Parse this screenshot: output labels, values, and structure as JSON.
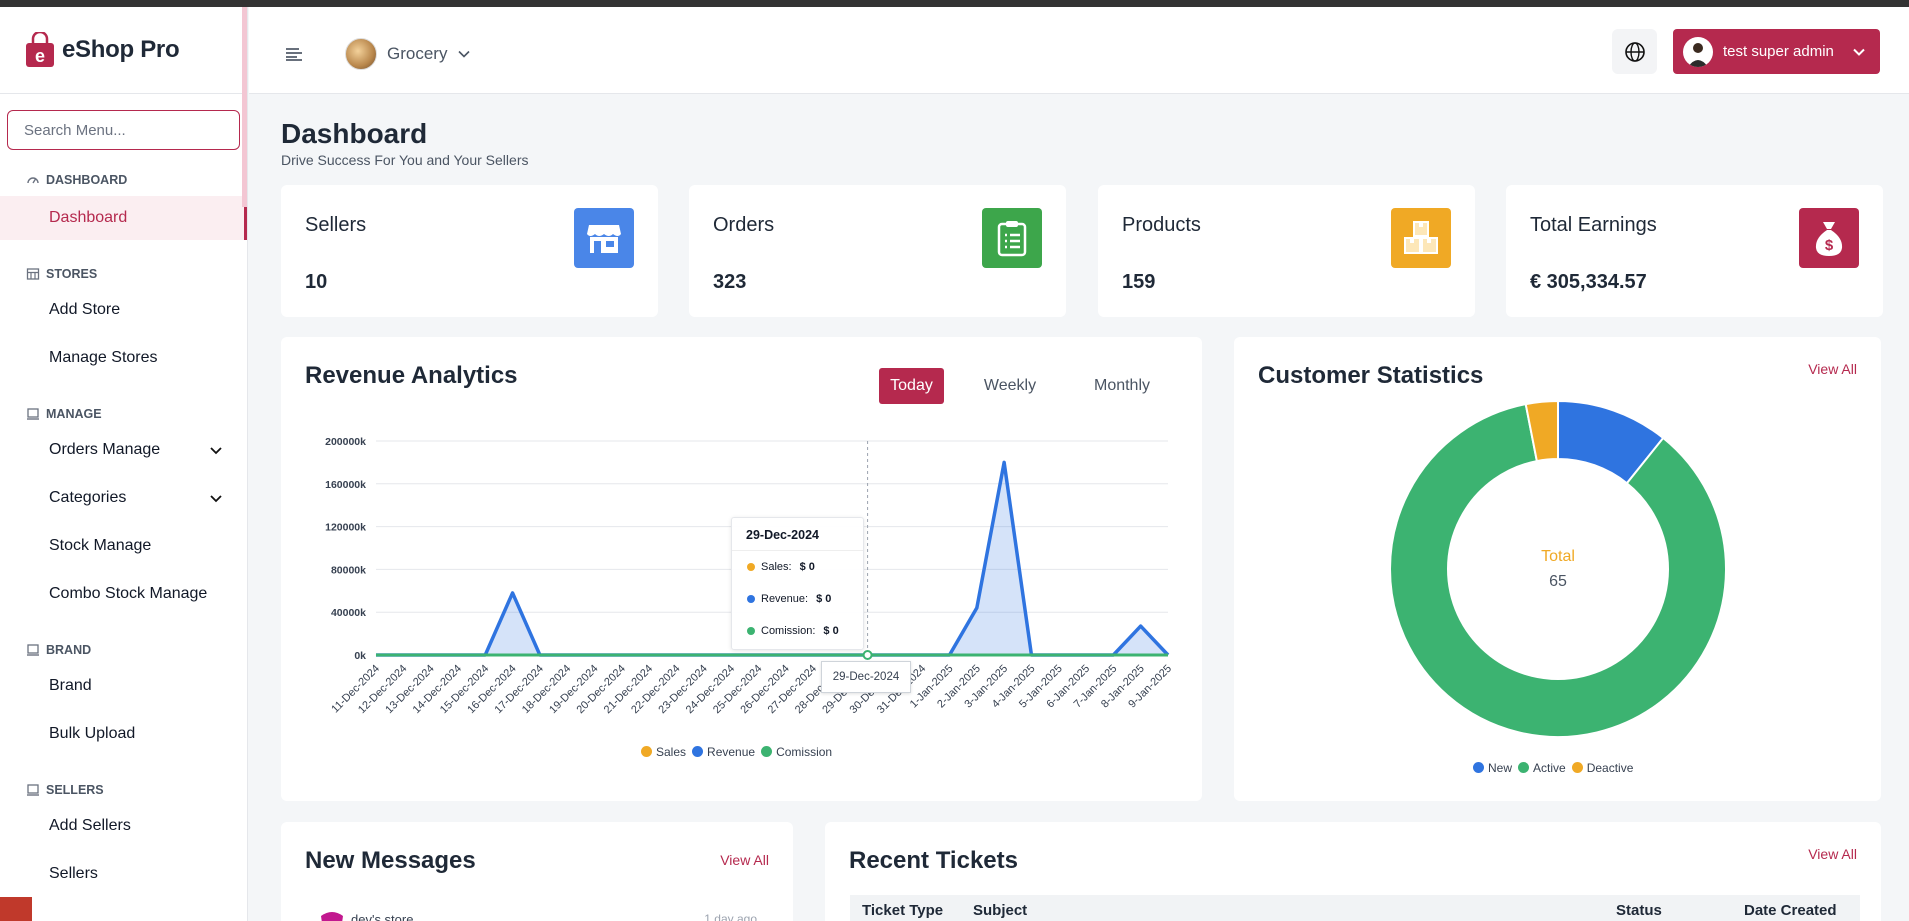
{
  "app": {
    "name": "eShop Pro"
  },
  "sidebar": {
    "search_placeholder": "Search Menu...",
    "sections": [
      {
        "title": "DASHBOARD",
        "items": [
          {
            "label": "Dashboard"
          }
        ]
      },
      {
        "title": "STORES",
        "items": [
          {
            "label": "Add Store"
          },
          {
            "label": "Manage Stores"
          }
        ]
      },
      {
        "title": "MANAGE",
        "items": [
          {
            "label": "Orders Manage"
          },
          {
            "label": "Categories"
          },
          {
            "label": "Stock Manage"
          },
          {
            "label": "Combo Stock Manage"
          }
        ]
      },
      {
        "title": "BRAND",
        "items": [
          {
            "label": "Brand"
          },
          {
            "label": "Bulk Upload"
          }
        ]
      },
      {
        "title": "SELLERS",
        "items": [
          {
            "label": "Add Sellers"
          },
          {
            "label": "Sellers"
          }
        ]
      }
    ]
  },
  "topbar": {
    "store_name": "Grocery",
    "user_name": "test super admin"
  },
  "page": {
    "title": "Dashboard",
    "subtitle": "Drive Success For You and Your Sellers"
  },
  "stats": [
    {
      "label": "Sellers",
      "value": "10",
      "color": "#4a86e8",
      "icon": "store-icon"
    },
    {
      "label": "Orders",
      "value": "323",
      "color": "#3da64b",
      "icon": "clipboard-icon"
    },
    {
      "label": "Products",
      "value": "159",
      "color": "#f0a925",
      "icon": "boxes-icon"
    },
    {
      "label": "Total Earnings",
      "value": "€ 305,334.57",
      "color": "#b5294e",
      "icon": "money-bag-icon"
    }
  ],
  "revenue": {
    "title": "Revenue Analytics",
    "ranges": [
      "Today",
      "Weekly",
      "Monthly"
    ],
    "active_range": "Today",
    "tooltip": {
      "date": "29-Dec-2024",
      "rows": [
        {
          "label": "Sales:",
          "value": "$ 0"
        },
        {
          "label": "Revenue:",
          "value": "$ 0"
        },
        {
          "label": "Comission:",
          "value": "$ 0"
        }
      ]
    },
    "x_tooltip": "29-Dec-2024"
  },
  "chart_data": {
    "type": "area",
    "y_tick_labels": [
      "0k",
      "40000k",
      "80000k",
      "120000k",
      "160000k",
      "200000k"
    ],
    "ylim": [
      0,
      200000
    ],
    "categories": [
      "11-Dec-2024",
      "12-Dec-2024",
      "13-Dec-2024",
      "14-Dec-2024",
      "15-Dec-2024",
      "16-Dec-2024",
      "17-Dec-2024",
      "18-Dec-2024",
      "19-Dec-2024",
      "20-Dec-2024",
      "21-Dec-2024",
      "22-Dec-2024",
      "23-Dec-2024",
      "24-Dec-2024",
      "25-Dec-2024",
      "26-Dec-2024",
      "27-Dec-2024",
      "28-Dec-2024",
      "29-Dec-2024",
      "30-Dec-2024",
      "31-Dec-2024",
      "1-Jan-2025",
      "2-Jan-2025",
      "3-Jan-2025",
      "4-Jan-2025",
      "5-Jan-2025",
      "6-Jan-2025",
      "7-Jan-2025",
      "8-Jan-2025",
      "9-Jan-2025"
    ],
    "series": [
      {
        "name": "Sales",
        "color": "#f0a925",
        "values": [
          0,
          0,
          0,
          0,
          0,
          0,
          0,
          0,
          0,
          0,
          0,
          0,
          0,
          0,
          0,
          0,
          0,
          0,
          0,
          0,
          0,
          0,
          0,
          0,
          0,
          0,
          0,
          0,
          0,
          0
        ]
      },
      {
        "name": "Revenue",
        "color": "#2f74e0",
        "values": [
          0,
          0,
          0,
          0,
          0,
          58000,
          0,
          0,
          0,
          0,
          0,
          0,
          0,
          0,
          0,
          0,
          0,
          0,
          0,
          0,
          0,
          0,
          44000,
          180000,
          0,
          0,
          0,
          0,
          27000,
          0
        ]
      },
      {
        "name": "Comission",
        "color": "#3cb371",
        "values": [
          0,
          0,
          0,
          0,
          0,
          0,
          0,
          0,
          0,
          0,
          0,
          0,
          0,
          0,
          0,
          0,
          0,
          0,
          0,
          0,
          0,
          0,
          0,
          0,
          0,
          0,
          0,
          0,
          0,
          0
        ]
      }
    ],
    "legend": [
      "Sales",
      "Revenue",
      "Comission"
    ]
  },
  "customer_stats": {
    "title": "Customer Statistics",
    "view_all": "View All",
    "center_label": "Total",
    "center_value": "65",
    "chart_data": {
      "type": "pie",
      "labels": [
        "New",
        "Active",
        "Deactive"
      ],
      "values": [
        7,
        56,
        2
      ],
      "colors": [
        "#2f74e0",
        "#3cb371",
        "#f0a925"
      ]
    }
  },
  "messages": {
    "title": "New Messages",
    "view_all": "View All",
    "first_item": {
      "name": "dev's store",
      "time": "1 day ago"
    }
  },
  "tickets": {
    "title": "Recent Tickets",
    "view_all": "View All",
    "columns": [
      "Ticket Type",
      "Subject",
      "Status",
      "Date Created"
    ]
  }
}
